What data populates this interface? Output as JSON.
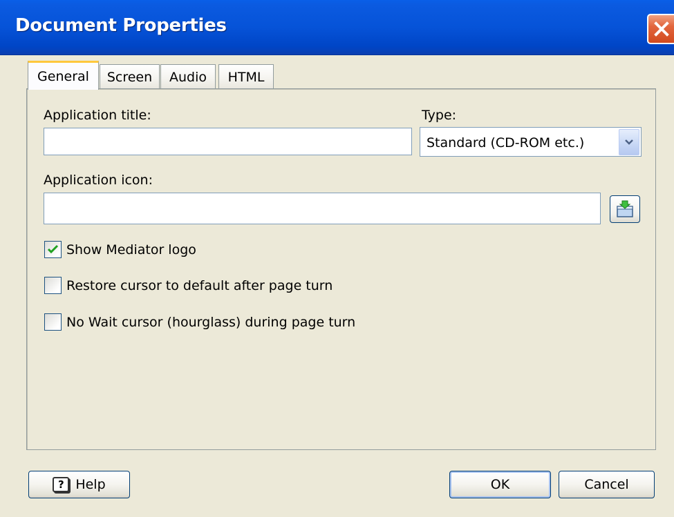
{
  "window": {
    "title": "Document Properties"
  },
  "tabs": [
    {
      "label": "General",
      "active": true
    },
    {
      "label": "Screen",
      "active": false
    },
    {
      "label": "Audio",
      "active": false
    },
    {
      "label": "HTML",
      "active": false
    }
  ],
  "general": {
    "application_title": {
      "label": "Application title:",
      "value": ""
    },
    "type": {
      "label": "Type:",
      "selected": "Standard (CD-ROM etc.)"
    },
    "application_icon": {
      "label": "Application icon:",
      "value": ""
    },
    "checkboxes": [
      {
        "label": "Show Mediator logo",
        "checked": true
      },
      {
        "label": "Restore cursor to default after page turn",
        "checked": false
      },
      {
        "label": "No Wait cursor (hourglass) during page turn",
        "checked": false
      }
    ]
  },
  "buttons": {
    "help": "Help",
    "help_icon_glyph": "?",
    "ok": "OK",
    "cancel": "Cancel"
  },
  "icons": {
    "close": "close-icon",
    "dropdown": "chevron-down-icon",
    "browse": "browse-file-icon",
    "help": "help-icon",
    "check": "checkmark-icon"
  },
  "colors": {
    "titlebar": "#0653D8",
    "close_button": "#D24A1E",
    "dialog_bg": "#ECE9D8",
    "active_tab_accent": "#FFC83C",
    "check": "#21A121"
  }
}
